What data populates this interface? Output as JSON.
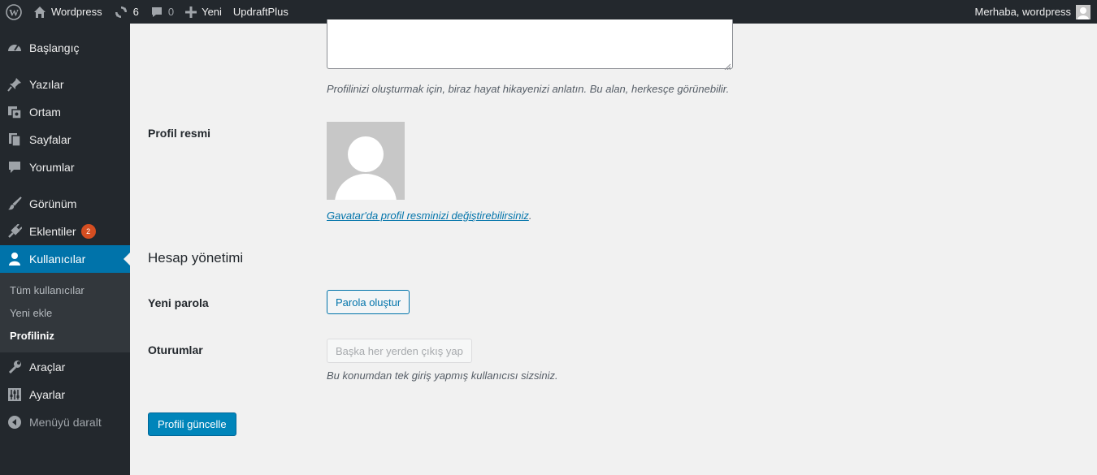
{
  "adminbar": {
    "site_name": "Wordpress",
    "updates_count": "6",
    "comments_count": "0",
    "new_label": "Yeni",
    "plugin_label": "UpdraftPlus",
    "greeting": "Merhaba, wordpress",
    "icons": [
      "wordpress-logo-icon",
      "home-icon",
      "updates-icon",
      "comments-icon",
      "plus-icon",
      "user-avatar-icon"
    ]
  },
  "sidebar": {
    "items": [
      {
        "label": "Başlangıç",
        "icon": "dashboard-icon"
      },
      {
        "label": "Yazılar",
        "icon": "pin-icon"
      },
      {
        "label": "Ortam",
        "icon": "media-icon"
      },
      {
        "label": "Sayfalar",
        "icon": "pages-icon"
      },
      {
        "label": "Yorumlar",
        "icon": "comments-icon"
      },
      {
        "label": "Görünüm",
        "icon": "appearance-icon"
      },
      {
        "label": "Eklentiler",
        "icon": "plugins-icon",
        "badge": "2"
      },
      {
        "label": "Kullanıcılar",
        "icon": "users-icon"
      },
      {
        "label": "Araçlar",
        "icon": "tools-icon"
      },
      {
        "label": "Ayarlar",
        "icon": "settings-icon"
      },
      {
        "label": "Menüyü daralt",
        "icon": "collapse-icon"
      }
    ],
    "submenu": [
      {
        "label": "Tüm kullanıcılar"
      },
      {
        "label": "Yeni ekle"
      },
      {
        "label": "Profiliniz"
      }
    ]
  },
  "profile": {
    "bio_description": "Profilinizi oluşturmak için, biraz hayat hikayenizi anlatın. Bu alan, herkesçe görünebilir.",
    "picture_label": "Profil resmi",
    "gravatar_link": "Gavatar'da profil resminizi değiştirebilirsiniz",
    "gravatar_suffix": ".",
    "account_title": "Hesap yönetimi",
    "new_password_label": "Yeni parola",
    "generate_password_button": "Parola oluştur",
    "sessions_label": "Oturumlar",
    "logout_everywhere_button": "Başka her yerden çıkış yap",
    "sessions_description": "Bu konumdan tek giriş yapmış kullanıcısı sizsiniz.",
    "update_button": "Profili güncelle"
  },
  "colors": {
    "accent": "#0073aa",
    "sidebar_bg": "#23282d",
    "badge": "#d54e21",
    "primary_button": "#0085ba"
  }
}
